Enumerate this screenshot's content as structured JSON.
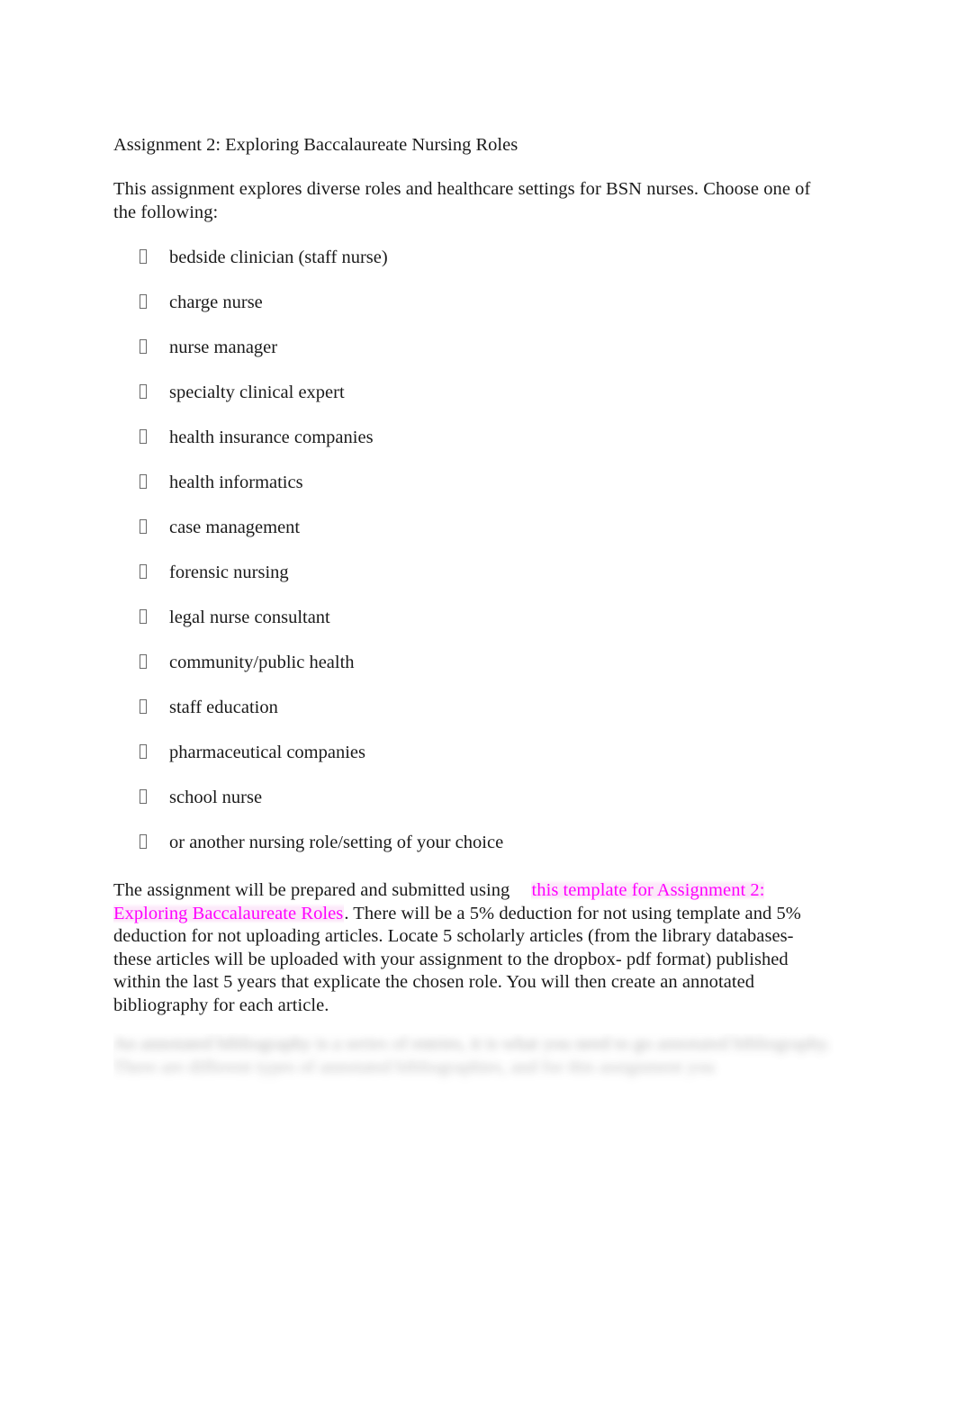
{
  "document": {
    "title": "Assignment 2: Exploring Baccalaureate Nursing Roles",
    "intro": "This assignment explores diverse roles and healthcare settings for BSN nurses. Choose one of the following:",
    "bullet_marker_glyph": "missing-glyph-box",
    "roles": [
      "bedside clinician (staff nurse)",
      "charge nurse",
      "nurse manager",
      "specialty clinical expert",
      "health insurance companies",
      "health informatics",
      "case management",
      "forensic nursing",
      "legal nurse consultant",
      "community/public health",
      "staff education",
      "pharmaceutical companies",
      "school nurse",
      "or another nursing role/setting of your choice"
    ],
    "submission_paragraph": {
      "lead": "The assignment will be prepared and submitted using",
      "link_text": "this template for Assignment 2: Exploring Baccalaureate Roles",
      "link_color": "#ff00ff",
      "highlight_color": "#fbe4f6",
      "tail": ". There will be a 5% deduction for not using template and 5% deduction for not uploading articles. Locate 5 scholarly articles (from the library databases- these articles will be uploaded with your assignment to the dropbox- pdf format) published within the last 5 years that explicate the chosen role. You will then create an annotated bibliography for each article."
    },
    "faded_paragraph": {
      "line1_lead": "An annotated bibliography is a ",
      "line1_link": "series of ",
      "line1_tail": "entries, it is what you need to go ",
      "line1_link2": "annotated",
      "line2_lead": "bibliography",
      "line2_tail": ". There are different types of annotated bibliographies, and for this assignment you"
    }
  }
}
